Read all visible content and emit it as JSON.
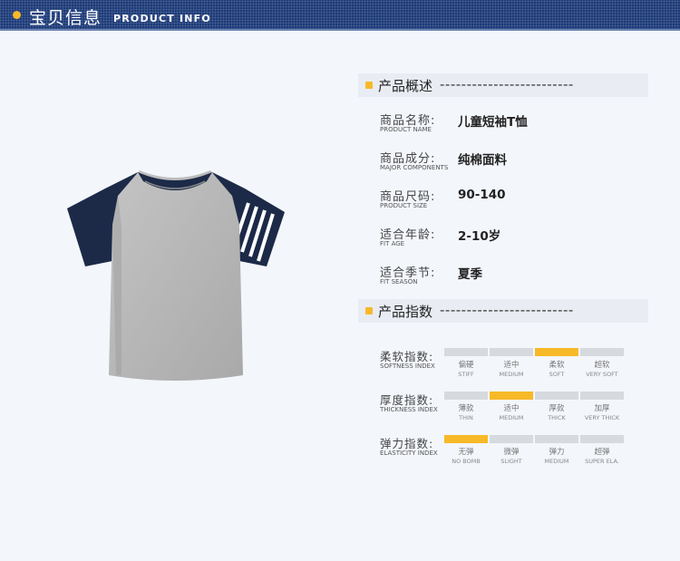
{
  "header": {
    "title": "宝贝信息",
    "subtitle": "PRODUCT INFO"
  },
  "overview": {
    "title": "产品概述",
    "dashes": "-------------------------",
    "rows": [
      {
        "label_cn": "商品名称:",
        "label_en": "PRODUCT NAME",
        "value": "儿童短袖T恤"
      },
      {
        "label_cn": "商品成分:",
        "label_en": "MAJOR COMPONENTS",
        "value": "纯棉面料"
      },
      {
        "label_cn": "商品尺码:",
        "label_en": "PRODUCT SIZE",
        "value": "90-140"
      },
      {
        "label_cn": "适合年龄:",
        "label_en": "FIT AGE",
        "value": "2-10岁"
      },
      {
        "label_cn": "适合季节:",
        "label_en": "FIT SEASON",
        "value": "夏季"
      }
    ]
  },
  "index": {
    "title": "产品指数",
    "dashes": "-------------------------",
    "rows": [
      {
        "label_cn": "柔软指数:",
        "label_en": "SOFTNESS INDEX",
        "selected": 2,
        "levels": [
          {
            "cn": "偏硬",
            "en": "STIFF"
          },
          {
            "cn": "适中",
            "en": "MEDIUM"
          },
          {
            "cn": "柔软",
            "en": "SOFT"
          },
          {
            "cn": "超软",
            "en": "VERY SOFT"
          }
        ]
      },
      {
        "label_cn": "厚度指数:",
        "label_en": "THICKNESS INDEX",
        "selected": 1,
        "levels": [
          {
            "cn": "薄款",
            "en": "THIN"
          },
          {
            "cn": "适中",
            "en": "MEDIUM"
          },
          {
            "cn": "厚款",
            "en": "THICK"
          },
          {
            "cn": "加厚",
            "en": "VERY THICK"
          }
        ]
      },
      {
        "label_cn": "弹力指数:",
        "label_en": "ELASTICITY INDEX",
        "selected": 0,
        "levels": [
          {
            "cn": "无弹",
            "en": "NO BOMB"
          },
          {
            "cn": "微弹",
            "en": "SLIGHT"
          },
          {
            "cn": "弹力",
            "en": "MEDIUM"
          },
          {
            "cn": "超弹",
            "en": "SUPER ELA."
          }
        ]
      }
    ]
  },
  "colors": {
    "header_bg": "#1d3b78",
    "accent": "#f7b928",
    "bar_inactive": "#d6d9de",
    "shirt_body": "#b7b7b7",
    "shirt_sleeve": "#1c2a48"
  }
}
